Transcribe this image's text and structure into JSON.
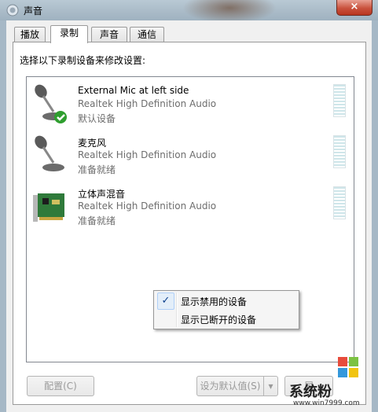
{
  "window": {
    "title": "声音",
    "close_label": "×"
  },
  "tabs": [
    {
      "label": "播放"
    },
    {
      "label": "录制",
      "active": true
    },
    {
      "label": "声音"
    },
    {
      "label": "通信"
    }
  ],
  "instruction": "选择以下录制设备来修改设置:",
  "devices": [
    {
      "name": "External Mic at left side",
      "driver": "Realtek High Definition Audio",
      "status": "默认设备",
      "icon": "microphone-icon"
    },
    {
      "name": "麦克风",
      "driver": "Realtek High Definition Audio",
      "status": "准备就绪",
      "icon": "microphone-icon"
    },
    {
      "name": "立体声混音",
      "driver": "Realtek High Definition Audio",
      "status": "准备就绪",
      "icon": "sound-card-icon"
    }
  ],
  "context_menu": {
    "items": [
      {
        "label": "显示禁用的设备",
        "checked": true
      },
      {
        "label": "显示已断开的设备",
        "checked": false
      }
    ]
  },
  "buttons": {
    "configure": "配置(C)",
    "set_default": "设为默认值(S)",
    "properties": "属"
  },
  "watermark": {
    "text": "系统粉",
    "url": "www.win7999.com"
  },
  "colors": {
    "title_bar": "#a9bac7",
    "close_button": "#c9523d",
    "check_green": "#2e9e2e"
  }
}
